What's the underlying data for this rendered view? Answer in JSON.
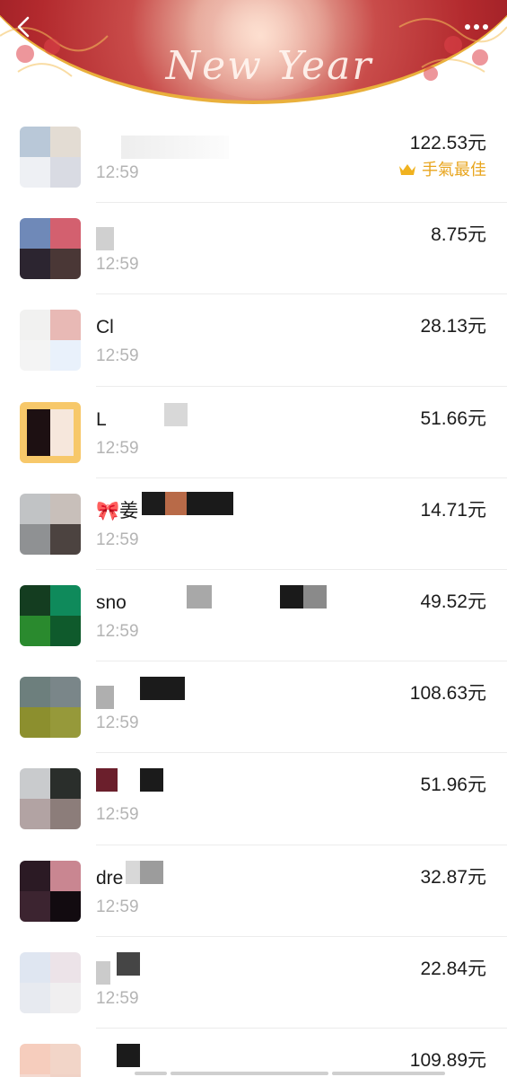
{
  "header": {
    "banner_text": "New Year",
    "back_icon": "chevron-left-icon",
    "more_icon": "more-dots-icon",
    "accent_gold": "#e9b03c",
    "banner_red": "#b32a2e"
  },
  "best_luck": {
    "label": "手氣最佳",
    "icon": "crown-icon",
    "color": "#e8a51e"
  },
  "records": [
    {
      "name": "",
      "time": "12:59",
      "amount": "122.53元",
      "best": true
    },
    {
      "name": "",
      "time": "12:59",
      "amount": "8.75元",
      "best": false
    },
    {
      "name": "Cl",
      "time": "12:59",
      "amount": "28.13元",
      "best": false
    },
    {
      "name": "L",
      "time": "12:59",
      "amount": "51.66元",
      "best": false
    },
    {
      "name": "🎀姜",
      "time": "12:59",
      "amount": "14.71元",
      "best": false
    },
    {
      "name": "sno",
      "time": "12:59",
      "amount": "49.52元",
      "best": false
    },
    {
      "name": "",
      "time": "12:59",
      "amount": "108.63元",
      "best": false
    },
    {
      "name": "",
      "time": "12:59",
      "amount": "51.96元",
      "best": false
    },
    {
      "name": "dre",
      "time": "12:59",
      "amount": "32.87元",
      "best": false
    },
    {
      "name": "",
      "time": "12:59",
      "amount": "22.84元",
      "best": false
    },
    {
      "name": "",
      "time": "",
      "amount": "109.89元",
      "best": false
    }
  ]
}
